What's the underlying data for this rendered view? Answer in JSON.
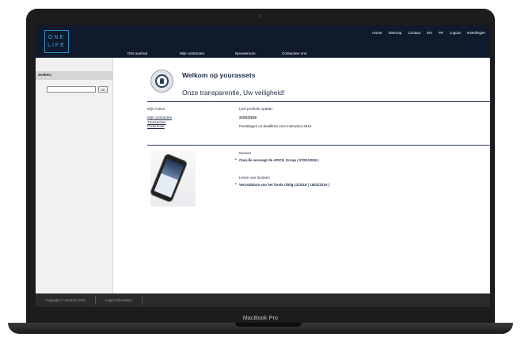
{
  "device": {
    "brand": "MacBook Pro"
  },
  "header": {
    "logo": {
      "line1": "ONE",
      "line2": "LIFE"
    },
    "util_nav": [
      "Home",
      "Sitemap",
      "Contact",
      "EN",
      "FR",
      "Logout",
      "Instellingen"
    ],
    "main_nav": [
      "Ons aanbod",
      "Mijn contracten",
      "Nieuwsroom",
      "Contacteer ons"
    ]
  },
  "sidebar": {
    "search_label": "Zoeken:",
    "search_value": "",
    "search_button": "OK"
  },
  "main": {
    "welcome_title": "Welkom op yourassets",
    "welcome_subtitle": "Onze transparentie, Uw veiligheid!",
    "assets_heading": "Mijn Activa",
    "asset_links": [
      "Mijn contracten",
      "Transacties",
      "Orderboek"
    ],
    "portfolio_heading": "Last portfolio update:",
    "portfolio_date": "21/01/2019",
    "portfolio_note": "Feestdagen en deadlines voor instructies 2018",
    "news_heading": "Nieuws",
    "news_item": "OneLife vervoegt de APICIL Group ( 07/01/2019 )",
    "funds_heading": "Leven van fondsen",
    "funds_item": "Vervaldatum van het fonds Oblig 12/2018 ( 15/01/2019 )"
  },
  "footer": {
    "copyright": "Copyright © OneLife 2019",
    "legal": "Legal Information"
  },
  "colors": {
    "header_bg": "#101a2d",
    "accent": "#2f8fc6",
    "text_dark": "#1a2a45",
    "footer_bg": "#2a2a2c"
  }
}
